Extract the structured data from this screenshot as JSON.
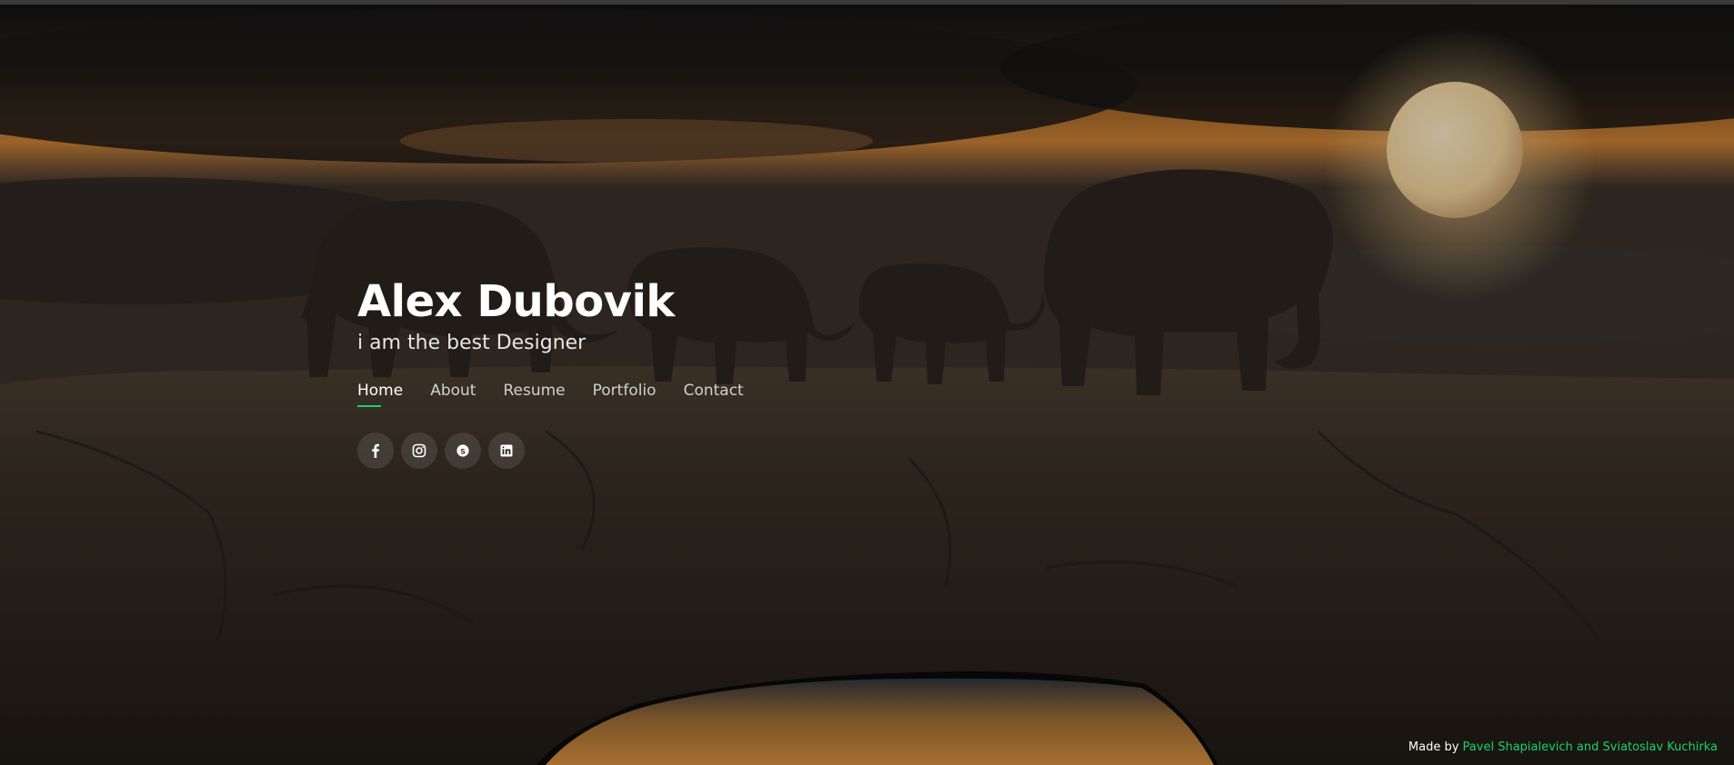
{
  "hero": {
    "name": "Alex Dubovik",
    "tagline": "i am the best Designer"
  },
  "nav": [
    {
      "label": "Home",
      "active": true
    },
    {
      "label": "About",
      "active": false
    },
    {
      "label": "Resume",
      "active": false
    },
    {
      "label": "Portfolio",
      "active": false
    },
    {
      "label": "Contact",
      "active": false
    }
  ],
  "social": [
    "facebook-icon",
    "instagram-icon",
    "skype-icon",
    "linkedin-icon"
  ],
  "credits": {
    "prefix": "Made by",
    "authors": "Pavel Shapialevich and Sviatoslav Kuchirka"
  },
  "colors": {
    "accent": "#18d26e",
    "text": "#ffffff"
  }
}
